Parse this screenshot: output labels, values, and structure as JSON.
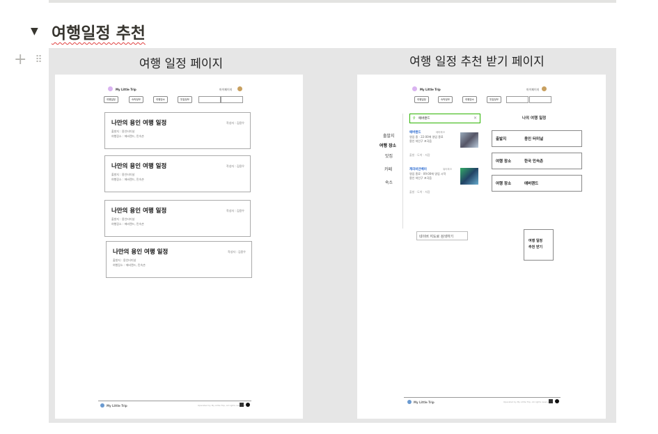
{
  "toggle": {
    "arrow": "▼",
    "title": "여행일정 추천"
  },
  "columns": {
    "left_title": "여행 일정 페이지",
    "right_title": "여행 일정 추천 받기 페이지"
  },
  "site": {
    "logo_text": "My Little Trip",
    "mypage": "마이페이지",
    "nav": [
      "여행일정",
      "숙박정보",
      "여행장소",
      "맛집정보"
    ],
    "footer_logo": "My Little Trip",
    "footer_copy": "Operated by My Little Trip, All rights reserved"
  },
  "left_page": {
    "cards": [
      {
        "title": "나만의 용인 여행 일정",
        "author": "작성자 : 김용우",
        "line1": "출발지 : 용인터미널",
        "line2": "여행장소 : 에버랜드, 민속촌"
      },
      {
        "title": "나만의 용인 여행 일정",
        "author": "작성자 : 김용우",
        "line1": "출발지 : 용인터미널",
        "line2": "여행장소 : 에버랜드, 민속촌"
      },
      {
        "title": "나만의 용인 여행 일정",
        "author": "작성자 : 김용우",
        "line1": "출발지 : 용인터미널",
        "line2": "여행장소 : 에버랜드, 민속촌"
      },
      {
        "title": "나만의 용인 여행 일정",
        "author": "작성자 : 김용우",
        "line1": "출발지 : 용인터미널",
        "line2": "여행장소 : 에버랜드, 민속촌"
      }
    ]
  },
  "right_page": {
    "search_value": "에버랜드",
    "sidebar": [
      "출발지",
      "여행 장소",
      "맛집",
      "카페",
      "숙소"
    ],
    "results": [
      {
        "name": "에버랜드",
        "tag": "테마파크",
        "hours": "영업 중 · 22:00에 영업 종료",
        "addr": "용인 처인구 포곡읍"
      },
      {
        "name": "캐리비안베이",
        "tag": "워터파크",
        "hours": "영업 종료 · 09:00에 영업 시작",
        "addr": "용인 처인구 포곡읍"
      }
    ],
    "action_labels": "출발 · 도착 · 저장",
    "map_search_button": "네이버 지도로 검색하기",
    "my_plan_title": "나의 여행 일정",
    "plan": [
      {
        "label": "출발지",
        "value": "용인 터미널"
      },
      {
        "label": "여행 장소",
        "value": "한국 민속촌"
      },
      {
        "label": "여행 장소",
        "value": "에버랜드"
      }
    ],
    "recommend_button_line1": "여행 일정",
    "recommend_button_line2": "추천 받기"
  },
  "colors": {
    "table_bg": "#e6e6e6",
    "accent_green": "#2db400",
    "logo_purple": "#d9b3f0"
  }
}
